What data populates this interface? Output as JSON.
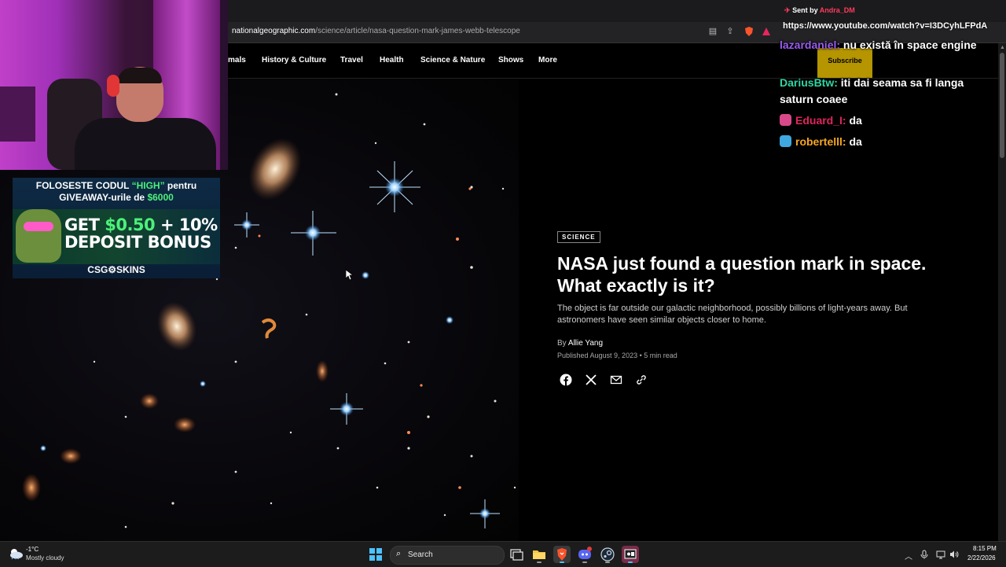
{
  "browser": {
    "url_host": "nationalgeographic.com",
    "url_path": "/science/article/nasa-question-mark-james-webb-telescope"
  },
  "site_nav": {
    "items": [
      "mals",
      "History & Culture",
      "Travel",
      "Health",
      "Science & Nature",
      "Shows",
      "More"
    ],
    "subscribe_label": "Subscribe"
  },
  "article": {
    "tag": "SCIENCE",
    "headline": "NASA just found a question mark in space. What exactly is it?",
    "dek": "The object is far outside our galactic neighborhood, possibly billions of light-years away. But astronomers have seen similar objects closer to home.",
    "byline_prefix": "By",
    "author": "Allie Yang",
    "published": "Published August 9, 2023",
    "read_time": "5 min read",
    "share_icons": [
      "facebook-icon",
      "x-icon",
      "email-icon",
      "link-icon"
    ]
  },
  "ad": {
    "line1_a": "FOLOSESTE CODUL ",
    "line1_b": "“HIGH”",
    "line1_c": " pentru",
    "line2_a": "GIVEAWAY-urile de ",
    "line2_b": "$6000",
    "big1_a": "GET ",
    "big1_b": "$0.50",
    "big1_c": " + 10%",
    "big2": "DEPOSIT BONUS",
    "brand": "CSG⚙SKINS"
  },
  "chat": {
    "sent_by_label": "Sent by",
    "sent_by_user": "Andra_DM",
    "sent_url": "https://www.youtube.com/watch?v=I3DCyhLFPdA",
    "messages": [
      {
        "user": "lazardaniel:",
        "text": "nu există în space engine",
        "color": "#9b5cf0"
      },
      {
        "user": "DariusBtw:",
        "text": "iti dai seama sa fi langa saturn coaee",
        "color": "#2fd6a3"
      },
      {
        "user": "Eduard_I:",
        "text": "da",
        "color": "#e0245e"
      },
      {
        "user": "robertelll:",
        "text": "da",
        "color": "#f5a623"
      }
    ]
  },
  "taskbar": {
    "weather_temp": "-1°C",
    "weather_desc": "Mostly cloudy",
    "search_label": "Search",
    "time": "8:15 PM",
    "date": "2/22/2026",
    "apps": [
      "file-explorer-icon",
      "brave-icon",
      "discord-icon",
      "steam-icon",
      "obs-icon"
    ]
  },
  "colors": {
    "accent_yellow": "#f2c700",
    "ad_green": "#4df07a"
  }
}
